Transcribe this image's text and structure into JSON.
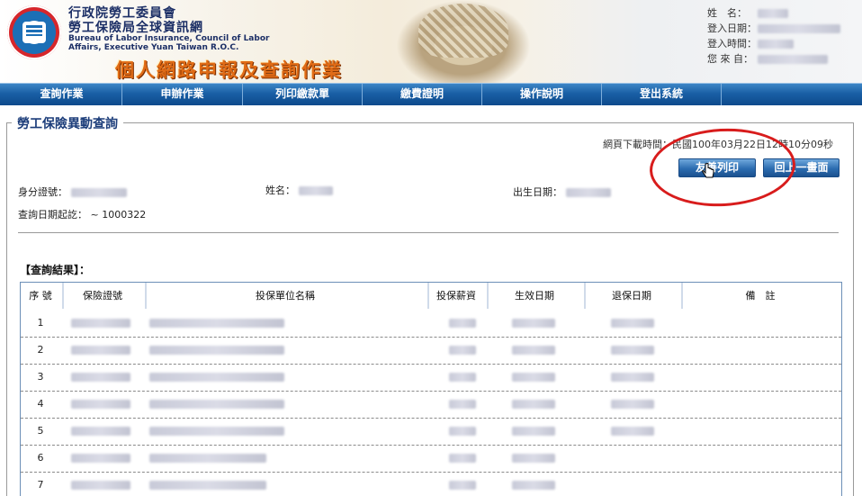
{
  "header": {
    "org_line1": "行政院勞工委員會",
    "org_line2": "勞工保險局全球資訊網",
    "org_en": "Bureau of Labor Insurance, Council of Labor Affairs, Executive Yuan Taiwan R.O.C.",
    "banner_title": "個人網路申報及查詢作業",
    "user_info": [
      {
        "label": "姓　名："
      },
      {
        "label": "登入日期："
      },
      {
        "label": "登入時間："
      },
      {
        "label": "您 來 自："
      }
    ]
  },
  "nav": {
    "items": [
      "查詢作業",
      "申辦作業",
      "列印繳款單",
      "繳費證明",
      "操作說明",
      "登出系統"
    ]
  },
  "page": {
    "title": "勞工保險異動查詢",
    "download_time": "網頁下載時間：民國100年03月22日12時10分09秒",
    "print_button": "友善列印",
    "back_button": "回上一畫面",
    "id_label": "身分證號：",
    "name_label": "姓名：",
    "birth_label": "出生日期：",
    "query_label": "查詢日期起訖：",
    "query_value": "~  1000322",
    "results_title": "【查詢結果】："
  },
  "table": {
    "headers": [
      "序 號",
      "保險證號",
      "投保單位名稱",
      "投保薪資",
      "生效日期",
      "退保日期",
      "備　註"
    ],
    "rows": [
      "1",
      "2",
      "3",
      "4",
      "5",
      "6",
      "7"
    ]
  },
  "colors": {
    "nav_blue": "#1a5fa5",
    "title_blue": "#1c3d7a",
    "banner_orange": "#e06b16",
    "annotation_red": "#d81c1c"
  }
}
